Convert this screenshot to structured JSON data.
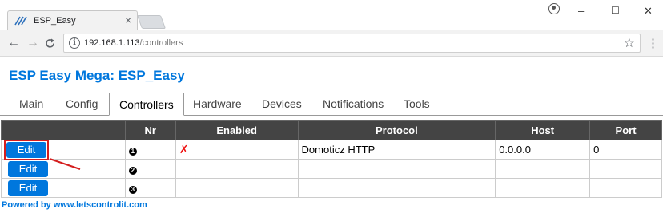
{
  "browser": {
    "tab_title": "ESP_Easy",
    "tab_close": "×",
    "url_host": "192.168.1.113",
    "url_path": "/controllers",
    "window_minimize": "–",
    "window_restore": "☐",
    "window_close": "✕",
    "back": "←",
    "forward": "→",
    "reload": "C",
    "star": "☆",
    "menu": "⋮"
  },
  "page": {
    "title": "ESP Easy Mega: ESP_Easy",
    "tabs": [
      {
        "label": "Main"
      },
      {
        "label": "Config"
      },
      {
        "label": "Controllers",
        "active": true
      },
      {
        "label": "Hardware"
      },
      {
        "label": "Devices"
      },
      {
        "label": "Notifications"
      },
      {
        "label": "Tools"
      }
    ],
    "footer": "Powered by www.letscontrolit.com"
  },
  "table": {
    "headers": [
      "",
      "Nr",
      "Enabled",
      "Protocol",
      "Host",
      "Port"
    ],
    "rows": [
      {
        "edit": "Edit",
        "nr": "1",
        "enabled": "✗",
        "protocol": "Domoticz HTTP",
        "host": "0.0.0.0",
        "port": "0"
      },
      {
        "edit": "Edit",
        "nr": "2",
        "enabled": "",
        "protocol": "",
        "host": "",
        "port": ""
      },
      {
        "edit": "Edit",
        "nr": "3",
        "enabled": "",
        "protocol": "",
        "host": "",
        "port": ""
      }
    ]
  },
  "colors": {
    "accent": "#0077dd",
    "header_bg": "#444444",
    "highlight": "#d41e1e"
  }
}
